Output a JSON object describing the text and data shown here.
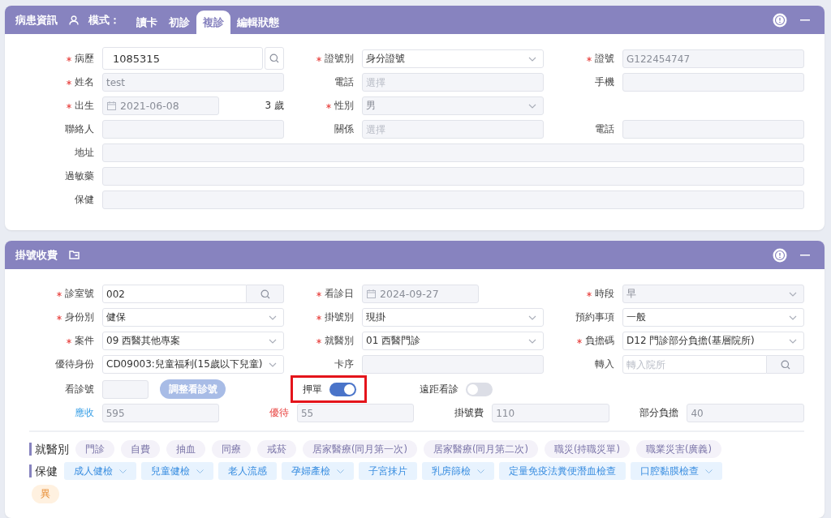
{
  "patient_panel": {
    "title": "病患資訊",
    "mode_label": "模式：",
    "tabs": [
      {
        "label": "讀卡",
        "selected": false
      },
      {
        "label": "初診",
        "selected": false
      },
      {
        "label": "複診",
        "selected": true
      },
      {
        "label": "編輯狀態",
        "selected": false
      }
    ],
    "rows": [
      [
        {
          "label": "病歷",
          "required": true,
          "kind": "search",
          "value": "1085315",
          "disabled": false
        },
        {
          "label": "證號別",
          "required": true,
          "kind": "select",
          "value": "身分證號",
          "disabled": false
        },
        {
          "label": "證號",
          "required": true,
          "kind": "input",
          "value": "G122454747",
          "disabled": true
        }
      ],
      [
        {
          "label": "姓名",
          "required": true,
          "kind": "input",
          "value": "test",
          "disabled": true
        },
        {
          "label": "電話",
          "required": false,
          "kind": "input",
          "placeholder": "選擇"
        },
        {
          "label": "手機",
          "required": false,
          "kind": "input"
        }
      ],
      [
        {
          "label": "出生",
          "required": true,
          "kind": "date",
          "value": "2021-06-08",
          "suffix": "3 歲",
          "disabled": true
        },
        {
          "label": "性別",
          "required": true,
          "kind": "select",
          "value": "男",
          "disabled": true
        }
      ],
      [
        {
          "label": "聯絡人",
          "required": false,
          "kind": "input"
        },
        {
          "label": "關係",
          "required": false,
          "kind": "input",
          "placeholder": "選擇"
        },
        {
          "label": "電話",
          "required": false,
          "kind": "input"
        }
      ],
      [
        {
          "label": "地址",
          "required": false,
          "kind": "wide"
        }
      ],
      [
        {
          "label": "過敏藥",
          "required": false,
          "kind": "wide"
        }
      ],
      [
        {
          "label": "保健",
          "required": false,
          "kind": "wide"
        }
      ]
    ]
  },
  "registration_panel": {
    "title": "掛號收費",
    "rows": [
      [
        {
          "label": "診室號",
          "required": true,
          "kind": "addon-search",
          "value": "002",
          "disabled": false
        },
        {
          "label": "看診日",
          "required": true,
          "kind": "date",
          "value": "2024-09-27",
          "disabled": true
        },
        {
          "label": "時段",
          "required": true,
          "kind": "select",
          "value": "早",
          "disabled": true
        }
      ],
      [
        {
          "label": "身份別",
          "required": true,
          "kind": "select",
          "value": "健保",
          "disabled": false
        },
        {
          "label": "掛號別",
          "required": true,
          "kind": "select",
          "value": "現掛",
          "disabled": false
        },
        {
          "label": "預約事項",
          "required": false,
          "kind": "select",
          "value": "一般",
          "disabled": false
        }
      ],
      [
        {
          "label": "案件",
          "required": true,
          "kind": "select",
          "value": "09 西醫其他專案",
          "disabled": false
        },
        {
          "label": "就醫別",
          "required": true,
          "kind": "select",
          "value": "01 西醫門診",
          "disabled": false
        },
        {
          "label": "負擔碼",
          "required": true,
          "kind": "select",
          "value": "D12 門診部分負擔(基層院所)",
          "disabled": false
        }
      ],
      [
        {
          "label": "優待身份",
          "required": false,
          "kind": "select",
          "value": "CD09003:兒童福利(15歲以下兒童)",
          "disabled": false
        },
        {
          "label": "卡序",
          "required": false,
          "kind": "input"
        },
        {
          "label": "轉入",
          "required": false,
          "kind": "addon-search",
          "placeholder": "轉入院所"
        }
      ]
    ],
    "queue_no": {
      "label": "看診號"
    },
    "adjust_button": {
      "label": "調整看診號",
      "disabled": true
    },
    "toggles": [
      {
        "label": "押單",
        "on": true,
        "highlighted": true
      },
      {
        "label": "遠距看診",
        "on": false,
        "highlighted": false
      }
    ],
    "fees": [
      {
        "label": "應收",
        "value": "595",
        "kind": "receivable"
      },
      {
        "label": "優待",
        "value": "55",
        "kind": "discount"
      },
      {
        "label": "掛號費",
        "value": "110",
        "kind": "plain"
      },
      {
        "label": "部分負擔",
        "value": "40",
        "kind": "plain"
      }
    ],
    "visit_type": {
      "label": "就醫別",
      "tags": [
        "門診",
        "自費",
        "抽血",
        "同療",
        "戒菸",
        "居家醫療(同月第一次)",
        "居家醫療(同月第二次)",
        "職災(持職災單)",
        "職業災害(廣義)"
      ]
    },
    "health_check": {
      "label": "保健",
      "tags": [
        {
          "label": "成人健檢",
          "dropdown": true
        },
        {
          "label": "兒童健檢",
          "dropdown": true
        },
        {
          "label": "老人流感",
          "dropdown": false
        },
        {
          "label": "孕婦產檢",
          "dropdown": true
        },
        {
          "label": "子宮抹片",
          "dropdown": false
        },
        {
          "label": "乳房篩檢",
          "dropdown": true
        },
        {
          "label": "定量免疫法糞便潛血檢查",
          "dropdown": false
        },
        {
          "label": "口腔黏膜檢查",
          "dropdown": true
        }
      ]
    },
    "extra_tags": [
      "異"
    ]
  }
}
